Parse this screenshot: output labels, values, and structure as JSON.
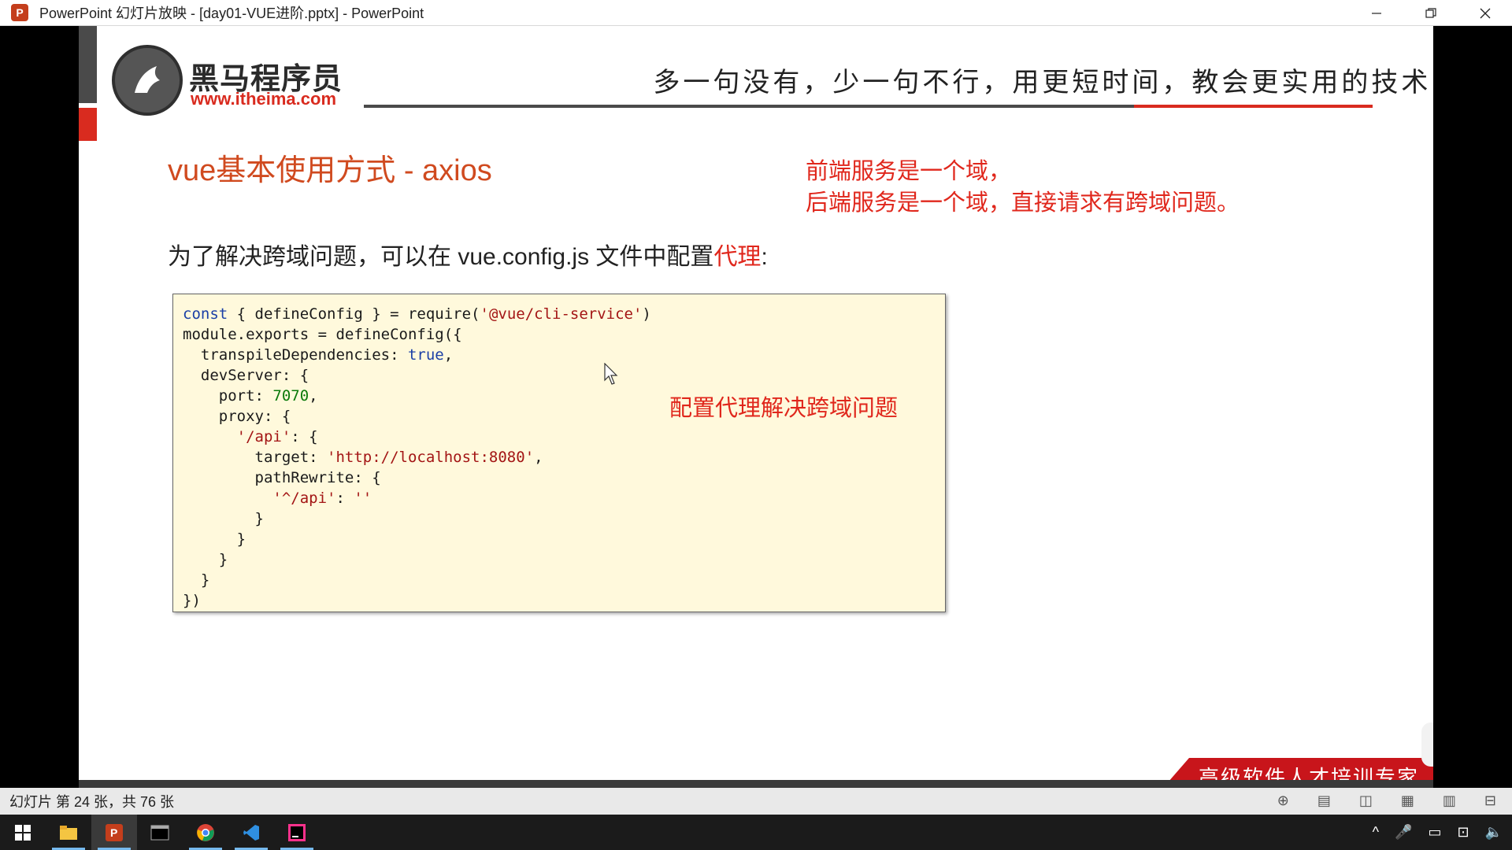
{
  "window": {
    "app_icon": "P",
    "title": "PowerPoint 幻灯片放映 - [day01-VUE进阶.pptx] - PowerPoint",
    "minimize_icon": "minimize-icon",
    "restore_icon": "restore-icon",
    "close_icon": "close-icon"
  },
  "slide": {
    "logo_name": "黑马程序员",
    "logo_url": "www.itheima.com",
    "slogan": "多一句没有，少一句不行，用更短时间，教会更实用的技术!",
    "title": "vue基本使用方式 - axios",
    "note_line1": "前端服务是一个域，",
    "note_line2": "后端服务是一个域，直接请求有跨域问题。",
    "intro_prefix": "为了解决跨域问题，可以在 vue.config.js 文件中配置",
    "intro_highlight": "代理",
    "intro_suffix": ":",
    "code_note": "配置代理解决跨域问题",
    "banner": "高级软件人才培训专家",
    "code": {
      "l1_kw": "const",
      "l1_a": " { defineConfig } = require(",
      "l1_str": "'@vue/cli-service'",
      "l1_b": ")",
      "l2": "module.exports = defineConfig({",
      "l3_a": "  transpileDependencies: ",
      "l3_kw": "true",
      "l3_b": ",",
      "l4": "  devServer: {",
      "l5_a": "    port: ",
      "l5_num": "7070",
      "l5_b": ",",
      "l6": "    proxy: {",
      "l7_a": "      ",
      "l7_str": "'/api'",
      "l7_b": ": {",
      "l8_a": "        target: ",
      "l8_str": "'http://localhost:8080'",
      "l8_b": ",",
      "l9": "        pathRewrite: {",
      "l10_a": "          ",
      "l10_str": "'^/api'",
      "l10_b": ": ",
      "l10_str2": "''",
      "l11": "        }",
      "l12": "      }",
      "l13": "    }",
      "l14": "  }",
      "l15": "})"
    }
  },
  "statusbar": {
    "text": "幻灯片 第 24 张，共 76 张"
  },
  "taskbar": {
    "items": [
      "windows-start",
      "file-explorer",
      "powerpoint",
      "terminal",
      "chrome",
      "vscode",
      "jetbrains-ide"
    ]
  }
}
